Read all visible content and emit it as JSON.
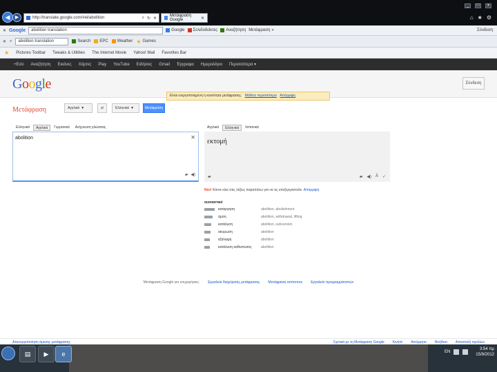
{
  "browser": {
    "url": "http://translate.google.com/#el/abolition",
    "tab_title": "Μετάφραση Google",
    "search_box": "abolition translation",
    "toolbar_right": "Σύνδεση",
    "menu_items": [
      "Google",
      "Σελιδοδείκτες",
      "Αναζήτηση",
      "Μετάφραση"
    ],
    "toolbar2_items": [
      "Search",
      "EPC",
      "Weather",
      "Games"
    ],
    "favorites": [
      "Pictures Toolbar",
      "Tweaks & Utilities",
      "The Internet Movie",
      "Yahoo! Mail",
      "Favorites Bar"
    ],
    "google_bar": [
      "+Εσύ",
      "Αναζήτηση",
      "Εικόνες",
      "Χάρτες",
      "Play",
      "YouTube",
      "Ειδήσεις",
      "Gmail",
      "Έγγραφα",
      "Ημερολόγιο",
      "Περισσότερα ▾"
    ]
  },
  "header": {
    "logo_letters": [
      "G",
      "o",
      "o",
      "g",
      "l",
      "e"
    ],
    "signin": "Σύνδεση",
    "notice_text": "Είναι ενεργοποιημένη η κοινότητα μετάφρασης.",
    "notice_link1": "Μάθετε περισσότερα",
    "notice_link2": "Απόρριψη"
  },
  "translate": {
    "title": "Μετάφραση",
    "source_lang": "Αγγλικά",
    "target_lang": "Ελληνικά",
    "swap": "⇄",
    "translate_btn": "Μετάφραση",
    "source_tabs": [
      "Ελληνικά",
      "Αγγλικά",
      "Γερμανικά",
      "Ανίχνευση γλώσσας"
    ],
    "target_tabs": [
      "Αγγλικά",
      "Ελληνικά",
      "Ισπανικά"
    ],
    "source_text": "abolition",
    "target_text": "εκτομή",
    "new_label": "Νέο!",
    "new_note": "Κάντε κλικ στις λέξεις παραπάνω για να τις επεξεργαστείτε.",
    "new_link": "Απόρριψη"
  },
  "dictionary": {
    "heading": "ουσιαστικό",
    "rows": [
      {
        "word": "κατάργηση",
        "trans": "abolition, abolishment",
        "bar": 0.9
      },
      {
        "word": "άρση",
        "trans": "abolition, withdrawal, lifting",
        "bar": 0.7
      },
      {
        "word": "κατάλυση",
        "trans": "abolition, subversion",
        "bar": 0.5
      },
      {
        "word": "ακύρωση",
        "trans": "abolition",
        "bar": 0.4
      },
      {
        "word": "εξάλειψη",
        "trans": "abolition",
        "bar": 0.35
      },
      {
        "word": "κατάλυση καθεστώτος",
        "trans": "abolition",
        "bar": 0.3
      }
    ]
  },
  "footer": {
    "plain": "Μετάφραση Google για επιχειρήσεις:",
    "links": [
      "Εργαλεία διαχείρισης μετάφρασης",
      "Μετάφραση ιστότοπου",
      "Εργαλείο προγραμματιστών"
    ],
    "bottom_left": "Απενεργοποίηση άμεσης μετάφρασης",
    "bottom_right": [
      "Σχετικά με τη Μετάφραση Google",
      "Κινητό",
      "Απόρρητο",
      "Βοήθεια",
      "Αποστολή σχολίων"
    ]
  },
  "taskbar": {
    "time": "3:54 πμ",
    "date": "15/9/2012",
    "lang": "EN"
  }
}
